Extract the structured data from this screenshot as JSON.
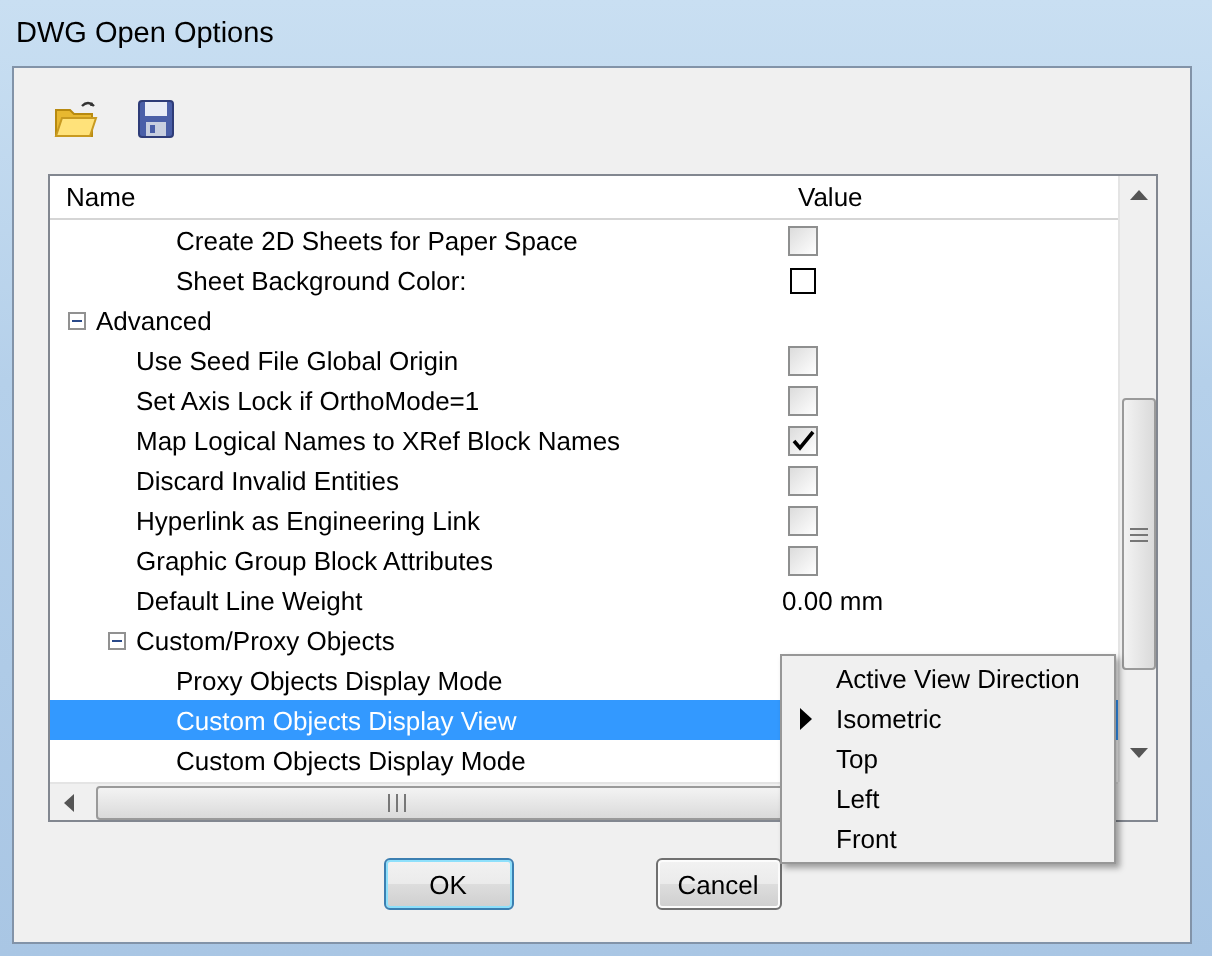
{
  "window": {
    "title": "DWG Open Options"
  },
  "grid": {
    "columns": [
      "Name",
      "Value"
    ],
    "rows": [
      {
        "kind": "continued",
        "children": [
          {
            "kind": "continued",
            "children": [
              {
                "kind": "checkbox",
                "label": "Create 2D Sheets for Paper Space",
                "checked": false,
                "selected": false
              },
              {
                "kind": "swatch",
                "label": "Sheet Background Color:",
                "color": "#ffffff",
                "selected": false
              }
            ]
          }
        ]
      },
      {
        "kind": "group",
        "label": "Advanced",
        "expanded": true,
        "selected": false,
        "children": [
          {
            "kind": "checkbox",
            "label": "Use Seed File Global Origin",
            "checked": false,
            "selected": false
          },
          {
            "kind": "checkbox",
            "label": "Set Axis Lock if OrthoMode=1",
            "checked": false,
            "selected": false
          },
          {
            "kind": "checkbox",
            "label": "Map Logical Names to XRef Block Names",
            "checked": true,
            "selected": false
          },
          {
            "kind": "checkbox",
            "label": "Discard Invalid Entities",
            "checked": false,
            "selected": false
          },
          {
            "kind": "checkbox",
            "label": "Hyperlink as Engineering Link",
            "checked": false,
            "selected": false
          },
          {
            "kind": "checkbox",
            "label": "Graphic Group Block Attributes",
            "checked": false,
            "selected": false
          },
          {
            "kind": "text",
            "label": "Default Line Weight",
            "value": "0.00 mm",
            "selected": false
          },
          {
            "kind": "group",
            "label": "Custom/Proxy Objects",
            "expanded": true,
            "selected": false,
            "children": [
              {
                "kind": "text",
                "label": "Proxy Objects Display Mode",
                "selected": false
              },
              {
                "kind": "text",
                "label": "Custom Objects Display View",
                "selected": true
              },
              {
                "kind": "text",
                "label": "Custom Objects Display Mode",
                "selected": false
              }
            ]
          }
        ]
      }
    ]
  },
  "menu": {
    "items": [
      {
        "label": "Active View Direction",
        "selected": false
      },
      {
        "label": "Isometric",
        "selected": true
      },
      {
        "label": "Top",
        "selected": false
      },
      {
        "label": "Left",
        "selected": false
      },
      {
        "label": "Front",
        "selected": false
      }
    ]
  },
  "buttons": [
    {
      "label": "OK",
      "default": true
    },
    {
      "label": "Cancel",
      "default": false
    }
  ]
}
